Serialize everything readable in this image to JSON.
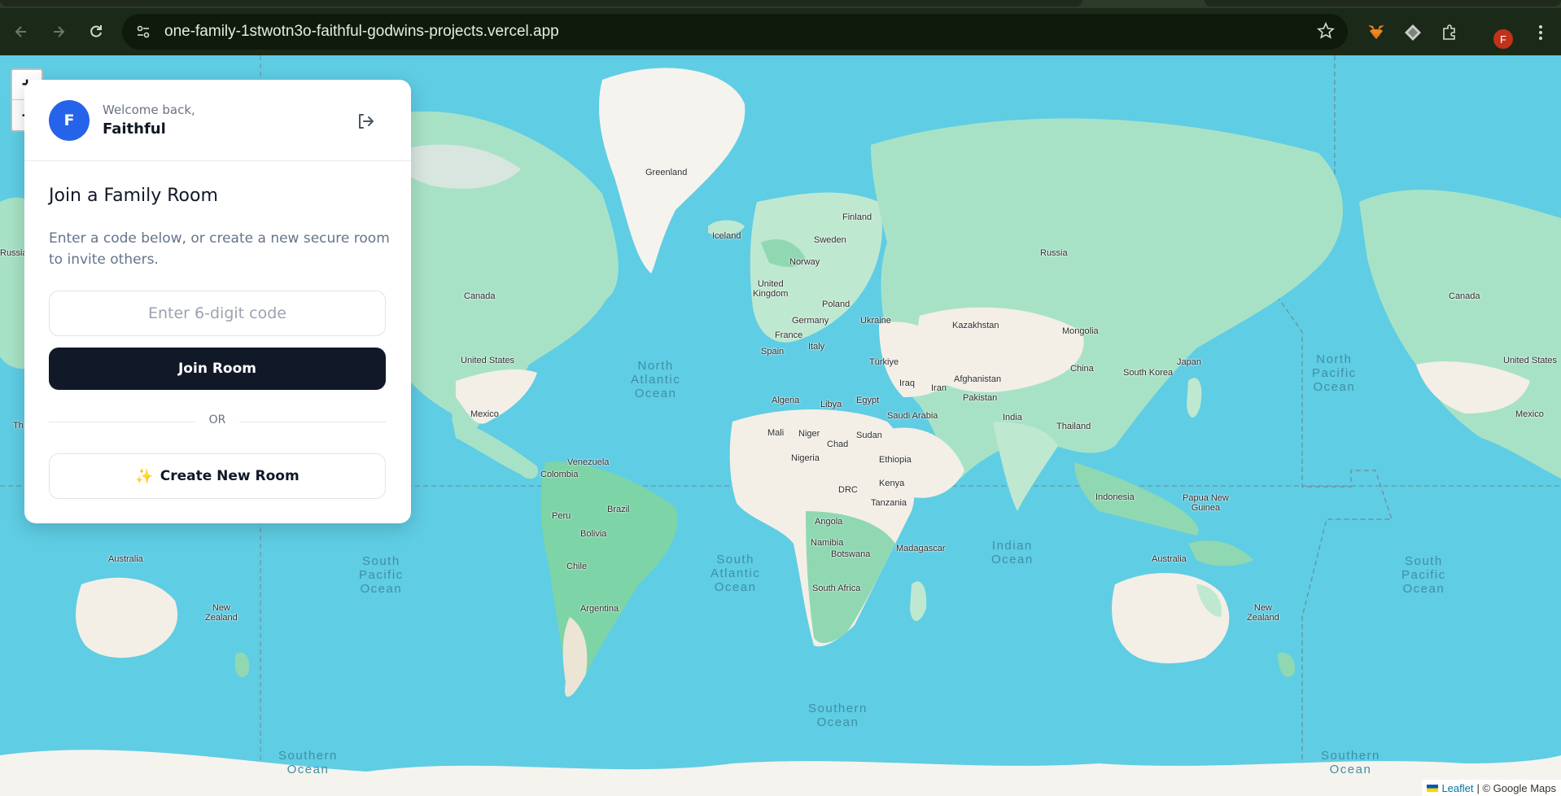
{
  "browser": {
    "url": "one-family-1stwotn3o-faithful-godwins-projects.vercel.app",
    "profile_initial": "F",
    "icons": [
      "back-icon",
      "forward-icon",
      "reload-icon",
      "site-settings-icon",
      "bookmark-star-icon",
      "metamask-fox-icon",
      "extension-diamond-icon",
      "extensions-puzzle-icon",
      "menu-dots-icon"
    ]
  },
  "map": {
    "zoom_in": "+",
    "zoom_out": "−",
    "labels": {
      "greenland": "Greenland",
      "iceland": "Iceland",
      "finland": "Finland",
      "sweden": "Sweden",
      "norway": "Norway",
      "russia": "Russia",
      "russia_left": "Russia",
      "canada": "Canada",
      "canada_right": "Canada",
      "united_kingdom": "United\nKingdom",
      "poland": "Poland",
      "germany": "Germany",
      "ukraine": "Ukraine",
      "france": "France",
      "italy": "Italy",
      "spain": "Spain",
      "kazakhstan": "Kazakhstan",
      "mongolia": "Mongolia",
      "turkiye": "Türkiye",
      "iraq": "Iraq",
      "iran": "Iran",
      "afghanistan": "Afghanistan",
      "pakistan": "Pakistan",
      "china": "China",
      "south_korea": "South Korea",
      "japan": "Japan",
      "india": "India",
      "thailand": "Thailand",
      "united_states": "United States",
      "united_states_right": "United States",
      "mexico": "Mexico",
      "mexico_right": "Mexico",
      "algeria": "Algeria",
      "libya": "Libya",
      "egypt": "Egypt",
      "saudi_arabia": "Saudi Arabia",
      "mali": "Mali",
      "niger": "Niger",
      "chad": "Chad",
      "sudan": "Sudan",
      "nigeria": "Nigeria",
      "ethiopia": "Ethiopia",
      "kenya": "Kenya",
      "drc": "DRC",
      "tanzania": "Tanzania",
      "angola": "Angola",
      "namibia": "Namibia",
      "botswana": "Botswana",
      "madagascar": "Madagascar",
      "south_africa": "South Africa",
      "venezuela": "Venezuela",
      "colombia": "Colombia",
      "peru": "Peru",
      "brazil": "Brazil",
      "bolivia": "Bolivia",
      "chile": "Chile",
      "argentina": "Argentina",
      "indonesia": "Indonesia",
      "papua_new_guinea": "Papua New\nGuinea",
      "australia": "Australia",
      "australia_left": "Australia",
      "new_zealand": "New\nZealand",
      "new_zealand_left": "New\nZealand",
      "th": "Th"
    },
    "oceans": {
      "north_atlantic": "North\nAtlantic\nOcean",
      "north_pacific": "North\nPacific\nOcean",
      "south_pacific_left": "South\nPacific\nOcean",
      "south_pacific_right": "South\nPacific\nOcean",
      "south_atlantic": "South\nAtlantic\nOcean",
      "indian": "Indian\nOcean",
      "southern_center": "Southern\nOcean",
      "southern_left": "Southern\nOcean",
      "southern_right": "Southern\nOcean"
    },
    "attribution": {
      "leaflet": "Leaflet",
      "rest": "| © Google Maps"
    }
  },
  "panel": {
    "avatar_initial": "F",
    "welcome": "Welcome back,",
    "username": "Faithful",
    "title": "Join a Family Room",
    "description": "Enter a code below, or create a new secure room to invite others.",
    "code_placeholder": "Enter 6-digit code",
    "code_value": "",
    "join_label": "Join Room",
    "or_label": "OR",
    "create_label": "Create New Room",
    "colors": {
      "avatar": "#2563eb",
      "primary_button": "#111827",
      "accent_sparkle": "#f5a623"
    }
  }
}
